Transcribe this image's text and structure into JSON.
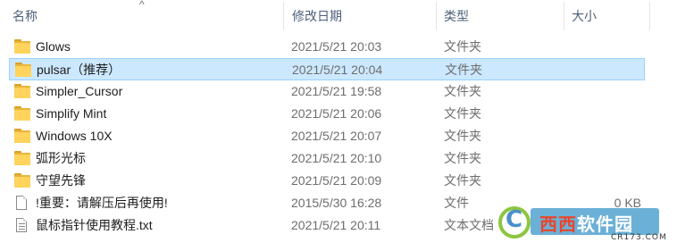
{
  "header": {
    "col_name": "名称",
    "col_date": "修改日期",
    "col_type": "类型",
    "col_size": "大小",
    "sort_indicator": "^"
  },
  "files": [
    {
      "name": "Glows",
      "date": "2021/5/21 20:03",
      "type": "文件夹",
      "size": "",
      "icon": "folder-icon",
      "selected": false
    },
    {
      "name": "pulsar（推荐）",
      "date": "2021/5/21 20:04",
      "type": "文件夹",
      "size": "",
      "icon": "folder-icon",
      "selected": true
    },
    {
      "name": "Simpler_Cursor",
      "date": "2021/5/21 19:58",
      "type": "文件夹",
      "size": "",
      "icon": "folder-icon",
      "selected": false
    },
    {
      "name": "Simplify Mint",
      "date": "2021/5/21 20:06",
      "type": "文件夹",
      "size": "",
      "icon": "folder-icon",
      "selected": false
    },
    {
      "name": "Windows 10X",
      "date": "2021/5/21 20:07",
      "type": "文件夹",
      "size": "",
      "icon": "folder-icon",
      "selected": false
    },
    {
      "name": "弧形光标",
      "date": "2021/5/21 20:10",
      "type": "文件夹",
      "size": "",
      "icon": "folder-icon",
      "selected": false
    },
    {
      "name": "守望先锋",
      "date": "2021/5/21 20:09",
      "type": "文件夹",
      "size": "",
      "icon": "folder-icon",
      "selected": false
    },
    {
      "name": "!重要：请解压后再使用!",
      "date": "2015/5/30 16:28",
      "type": "文件",
      "size": "0 KB",
      "icon": "file-icon",
      "selected": false
    },
    {
      "name": "鼠标指针使用教程.txt",
      "date": "2021/5/21 20:11",
      "type": "文本文档",
      "size": "",
      "icon": "text-file-icon",
      "selected": false
    }
  ],
  "watermark": {
    "brand_part1": "西西",
    "brand_part2": "软件园",
    "sub": "CR173.COM"
  },
  "colors": {
    "selection_bg": "#cce8ff",
    "selection_border": "#99d1ff",
    "folder": "#ffd35c",
    "header_text": "#4c607a"
  }
}
